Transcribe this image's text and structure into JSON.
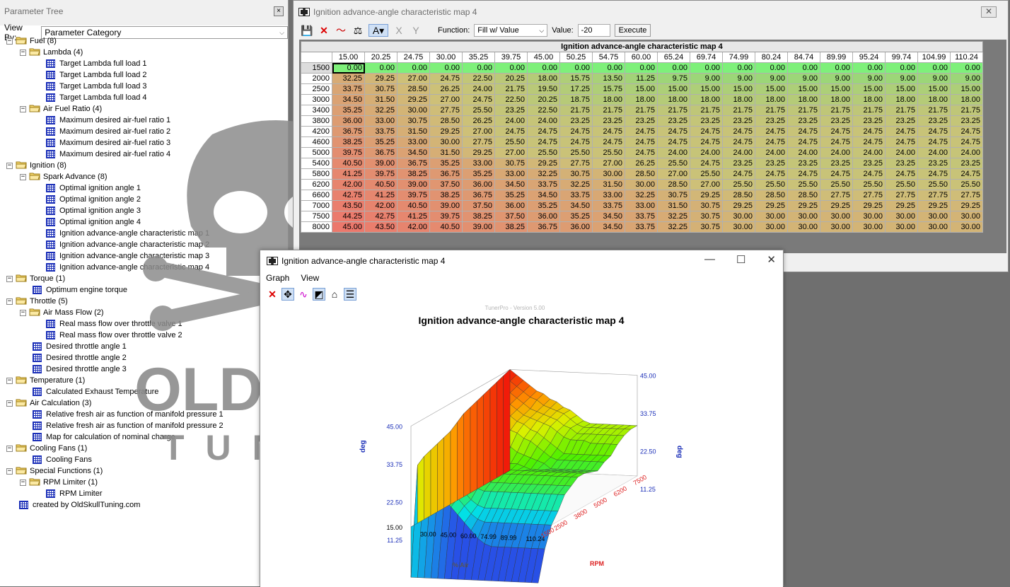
{
  "tree": {
    "title": "Parameter Tree",
    "close": "×",
    "view_by_label": "View By:",
    "view_by_value": "Parameter Category",
    "nodes": [
      {
        "label": "Fuel (8)",
        "level": 0,
        "kind": "folder"
      },
      {
        "label": "Lambda (4)",
        "level": 1,
        "kind": "folder"
      },
      {
        "label": "Target Lambda full load 1",
        "level": 2,
        "kind": "table"
      },
      {
        "label": "Target Lambda full load 2",
        "level": 2,
        "kind": "table"
      },
      {
        "label": "Target Lambda full load 3",
        "level": 2,
        "kind": "table"
      },
      {
        "label": "Target Lambda full load 4",
        "level": 2,
        "kind": "table"
      },
      {
        "label": "Air Fuel Ratio (4)",
        "level": 1,
        "kind": "folder"
      },
      {
        "label": "Maximum desired air-fuel ratio 1",
        "level": 2,
        "kind": "table"
      },
      {
        "label": "Maximum desired air-fuel ratio 2",
        "level": 2,
        "kind": "table"
      },
      {
        "label": "Maximum desired air-fuel ratio 3",
        "level": 2,
        "kind": "table"
      },
      {
        "label": "Maximum desired air-fuel ratio 4",
        "level": 2,
        "kind": "table"
      },
      {
        "label": "Ignition (8)",
        "level": 0,
        "kind": "folder"
      },
      {
        "label": "Spark Advance (8)",
        "level": 1,
        "kind": "folder"
      },
      {
        "label": "Optimal ignition angle 1",
        "level": 2,
        "kind": "table"
      },
      {
        "label": "Optimal ignition angle 2",
        "level": 2,
        "kind": "table"
      },
      {
        "label": "Optimal ignition angle 3",
        "level": 2,
        "kind": "table"
      },
      {
        "label": "Optimal ignition angle 4",
        "level": 2,
        "kind": "table"
      },
      {
        "label": "Ignition advance-angle characteristic map 1",
        "level": 2,
        "kind": "table"
      },
      {
        "label": "Ignition advance-angle characteristic map 2",
        "level": 2,
        "kind": "table"
      },
      {
        "label": "Ignition advance-angle characteristic map 3",
        "level": 2,
        "kind": "table"
      },
      {
        "label": "Ignition advance-angle characteristic map 4",
        "level": 2,
        "kind": "table"
      },
      {
        "label": "Torque (1)",
        "level": 0,
        "kind": "folder"
      },
      {
        "label": "Optimum engine torque",
        "level": 1,
        "kind": "table"
      },
      {
        "label": "Throttle (5)",
        "level": 0,
        "kind": "folder"
      },
      {
        "label": "Air Mass Flow (2)",
        "level": 1,
        "kind": "folder"
      },
      {
        "label": "Real mass flow over throttle valve 1",
        "level": 2,
        "kind": "table"
      },
      {
        "label": "Real mass flow over throttle valve 2",
        "level": 2,
        "kind": "table"
      },
      {
        "label": "Desired throttle angle 1",
        "level": 1,
        "kind": "table"
      },
      {
        "label": "Desired throttle angle 2",
        "level": 1,
        "kind": "table"
      },
      {
        "label": "Desired throttle angle 3",
        "level": 1,
        "kind": "table"
      },
      {
        "label": "Temperature (1)",
        "level": 0,
        "kind": "folder"
      },
      {
        "label": "Calculated Exhaust Temperature",
        "level": 1,
        "kind": "table"
      },
      {
        "label": "Air Calculation (3)",
        "level": 0,
        "kind": "folder"
      },
      {
        "label": "Relative fresh air as function of manifold pressure 1",
        "level": 1,
        "kind": "table"
      },
      {
        "label": "Relative fresh air as function of manifold pressure 2",
        "level": 1,
        "kind": "table"
      },
      {
        "label": "Map for calculation of nominal charge",
        "level": 1,
        "kind": "table"
      },
      {
        "label": "Cooling Fans (1)",
        "level": 0,
        "kind": "folder"
      },
      {
        "label": "Cooling Fans",
        "level": 1,
        "kind": "table"
      },
      {
        "label": "Special Functions (1)",
        "level": 0,
        "kind": "folder"
      },
      {
        "label": "RPM Limiter (1)",
        "level": 1,
        "kind": "folder"
      },
      {
        "label": "RPM Limiter",
        "level": 2,
        "kind": "table"
      },
      {
        "label": "created by OldSkullTuning.com",
        "level": 0,
        "kind": "table"
      }
    ]
  },
  "watermark": {
    "text": "OLDSKULL",
    "sub": "TUNING"
  },
  "table_window": {
    "title": "Ignition advance-angle characteristic map 4",
    "close": "✕",
    "function_label": "Function:",
    "function_value": "Fill w/ Value",
    "value_label": "Value:",
    "value": "-20",
    "execute": "Execute",
    "caption": "Ignition advance-angle characteristic map 4"
  },
  "map": {
    "cols": [
      "15.00",
      "20.25",
      "24.75",
      "30.00",
      "35.25",
      "39.75",
      "45.00",
      "50.25",
      "54.75",
      "60.00",
      "65.24",
      "69.74",
      "74.99",
      "80.24",
      "84.74",
      "89.99",
      "95.24",
      "99.74",
      "104.99",
      "110.24"
    ],
    "rows": [
      {
        "rpm": "1500",
        "v": [
          "0.00",
          "0.00",
          "0.00",
          "0.00",
          "0.00",
          "0.00",
          "0.00",
          "0.00",
          "0.00",
          "0.00",
          "0.00",
          "0.00",
          "0.00",
          "0.00",
          "0.00",
          "0.00",
          "0.00",
          "0.00",
          "0.00",
          "0.00"
        ]
      },
      {
        "rpm": "2000",
        "v": [
          "32.25",
          "29.25",
          "27.00",
          "24.75",
          "22.50",
          "20.25",
          "18.00",
          "15.75",
          "13.50",
          "11.25",
          "9.75",
          "9.00",
          "9.00",
          "9.00",
          "9.00",
          "9.00",
          "9.00",
          "9.00",
          "9.00",
          "9.00"
        ]
      },
      {
        "rpm": "2500",
        "v": [
          "33.75",
          "30.75",
          "28.50",
          "26.25",
          "24.00",
          "21.75",
          "19.50",
          "17.25",
          "15.75",
          "15.00",
          "15.00",
          "15.00",
          "15.00",
          "15.00",
          "15.00",
          "15.00",
          "15.00",
          "15.00",
          "15.00",
          "15.00"
        ]
      },
      {
        "rpm": "3000",
        "v": [
          "34.50",
          "31.50",
          "29.25",
          "27.00",
          "24.75",
          "22.50",
          "20.25",
          "18.75",
          "18.00",
          "18.00",
          "18.00",
          "18.00",
          "18.00",
          "18.00",
          "18.00",
          "18.00",
          "18.00",
          "18.00",
          "18.00",
          "18.00"
        ]
      },
      {
        "rpm": "3400",
        "v": [
          "35.25",
          "32.25",
          "30.00",
          "27.75",
          "25.50",
          "23.25",
          "22.50",
          "21.75",
          "21.75",
          "21.75",
          "21.75",
          "21.75",
          "21.75",
          "21.75",
          "21.75",
          "21.75",
          "21.75",
          "21.75",
          "21.75",
          "21.75"
        ]
      },
      {
        "rpm": "3800",
        "v": [
          "36.00",
          "33.00",
          "30.75",
          "28.50",
          "26.25",
          "24.00",
          "24.00",
          "23.25",
          "23.25",
          "23.25",
          "23.25",
          "23.25",
          "23.25",
          "23.25",
          "23.25",
          "23.25",
          "23.25",
          "23.25",
          "23.25",
          "23.25"
        ]
      },
      {
        "rpm": "4200",
        "v": [
          "36.75",
          "33.75",
          "31.50",
          "29.25",
          "27.00",
          "24.75",
          "24.75",
          "24.75",
          "24.75",
          "24.75",
          "24.75",
          "24.75",
          "24.75",
          "24.75",
          "24.75",
          "24.75",
          "24.75",
          "24.75",
          "24.75",
          "24.75"
        ]
      },
      {
        "rpm": "4600",
        "v": [
          "38.25",
          "35.25",
          "33.00",
          "30.00",
          "27.75",
          "25.50",
          "24.75",
          "24.75",
          "24.75",
          "24.75",
          "24.75",
          "24.75",
          "24.75",
          "24.75",
          "24.75",
          "24.75",
          "24.75",
          "24.75",
          "24.75",
          "24.75"
        ]
      },
      {
        "rpm": "5000",
        "v": [
          "39.75",
          "36.75",
          "34.50",
          "31.50",
          "29.25",
          "27.00",
          "25.50",
          "25.50",
          "25.50",
          "24.75",
          "24.00",
          "24.00",
          "24.00",
          "24.00",
          "24.00",
          "24.00",
          "24.00",
          "24.00",
          "24.00",
          "24.00"
        ]
      },
      {
        "rpm": "5400",
        "v": [
          "40.50",
          "39.00",
          "36.75",
          "35.25",
          "33.00",
          "30.75",
          "29.25",
          "27.75",
          "27.00",
          "26.25",
          "25.50",
          "24.75",
          "23.25",
          "23.25",
          "23.25",
          "23.25",
          "23.25",
          "23.25",
          "23.25",
          "23.25"
        ]
      },
      {
        "rpm": "5800",
        "v": [
          "41.25",
          "39.75",
          "38.25",
          "36.75",
          "35.25",
          "33.00",
          "32.25",
          "30.75",
          "30.00",
          "28.50",
          "27.00",
          "25.50",
          "24.75",
          "24.75",
          "24.75",
          "24.75",
          "24.75",
          "24.75",
          "24.75",
          "24.75"
        ]
      },
      {
        "rpm": "6200",
        "v": [
          "42.00",
          "40.50",
          "39.00",
          "37.50",
          "36.00",
          "34.50",
          "33.75",
          "32.25",
          "31.50",
          "30.00",
          "28.50",
          "27.00",
          "25.50",
          "25.50",
          "25.50",
          "25.50",
          "25.50",
          "25.50",
          "25.50",
          "25.50"
        ]
      },
      {
        "rpm": "6600",
        "v": [
          "42.75",
          "41.25",
          "39.75",
          "38.25",
          "36.75",
          "35.25",
          "34.50",
          "33.75",
          "33.00",
          "32.25",
          "30.75",
          "29.25",
          "28.50",
          "28.50",
          "28.50",
          "27.75",
          "27.75",
          "27.75",
          "27.75",
          "27.75"
        ]
      },
      {
        "rpm": "7000",
        "v": [
          "43.50",
          "42.00",
          "40.50",
          "39.00",
          "37.50",
          "36.00",
          "35.25",
          "34.50",
          "33.75",
          "33.00",
          "31.50",
          "30.75",
          "29.25",
          "29.25",
          "29.25",
          "29.25",
          "29.25",
          "29.25",
          "29.25",
          "29.25"
        ]
      },
      {
        "rpm": "7500",
        "v": [
          "44.25",
          "42.75",
          "41.25",
          "39.75",
          "38.25",
          "37.50",
          "36.00",
          "35.25",
          "34.50",
          "33.75",
          "32.25",
          "30.75",
          "30.00",
          "30.00",
          "30.00",
          "30.00",
          "30.00",
          "30.00",
          "30.00",
          "30.00"
        ]
      },
      {
        "rpm": "8000",
        "v": [
          "45.00",
          "43.50",
          "42.00",
          "40.50",
          "39.00",
          "38.25",
          "36.75",
          "36.00",
          "34.50",
          "33.75",
          "32.25",
          "30.75",
          "30.00",
          "30.00",
          "30.00",
          "30.00",
          "30.00",
          "30.00",
          "30.00",
          "30.00"
        ]
      }
    ]
  },
  "graph_window": {
    "title": "Ignition advance-angle characteristic map 4",
    "menu": [
      "Graph",
      "View"
    ],
    "minimize": "—",
    "maximize": "☐",
    "close": "✕"
  },
  "chart_data": {
    "type": "surface",
    "title": "Ignition advance-angle characteristic map 4",
    "watermark": "TunerPro - Version 5.00",
    "x_label": "% Air",
    "y_label": "RPM",
    "z_label": "deg",
    "z_ticks": [
      "15.00",
      "22.50",
      "33.75",
      "45.00",
      "11.25"
    ],
    "z_ticks_left": [
      "45.00",
      "33.75",
      "22.50",
      "11.25",
      "15.00"
    ],
    "z_ticks_right": [
      "45.00",
      "33.75",
      "22.50",
      "11.25"
    ],
    "x_ticks": [
      "30.00",
      "45.00",
      "60.00",
      "74.99",
      "89.99",
      "110.24"
    ],
    "y_ticks": [
      "1500",
      "2500",
      "3800",
      "5000",
      "6200",
      "7500"
    ],
    "grid": true
  },
  "colors": {
    "accent": "#1f3fbf",
    "title_blue": "#1b2fb8"
  }
}
